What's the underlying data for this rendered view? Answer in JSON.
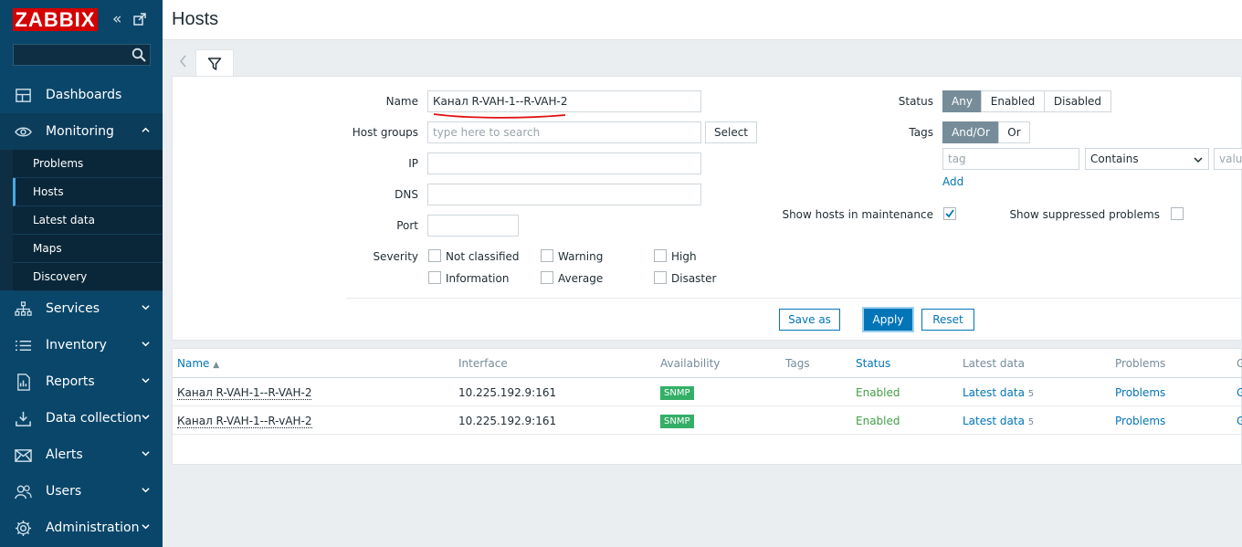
{
  "sidebar": {
    "logo": "ZABBIX",
    "collapse_glyph": "«",
    "expand_glyph": "⧉",
    "search_placeholder": "",
    "items": [
      {
        "label": "Dashboards",
        "icon": "dashboard-icon"
      },
      {
        "label": "Monitoring",
        "icon": "eye-icon"
      },
      {
        "label": "Services",
        "icon": "services-icon"
      },
      {
        "label": "Inventory",
        "icon": "list-icon"
      },
      {
        "label": "Reports",
        "icon": "reports-icon"
      },
      {
        "label": "Data collection",
        "icon": "download-icon"
      },
      {
        "label": "Alerts",
        "icon": "mail-icon"
      },
      {
        "label": "Users",
        "icon": "users-icon"
      },
      {
        "label": "Administration",
        "icon": "gear-icon"
      }
    ],
    "monitoring_sub": [
      "Problems",
      "Hosts",
      "Latest data",
      "Maps",
      "Discovery"
    ]
  },
  "header": {
    "title": "Hosts"
  },
  "filter": {
    "name_label": "Name",
    "name_value": "Канал R-VAH-1--R-VAH-2",
    "host_groups_label": "Host groups",
    "host_groups_placeholder": "type here to search",
    "select_label": "Select",
    "ip_label": "IP",
    "dns_label": "DNS",
    "port_label": "Port",
    "severity_label": "Severity",
    "severities": [
      "Not classified",
      "Warning",
      "High",
      "Information",
      "Average",
      "Disaster"
    ],
    "status_label": "Status",
    "status_options": [
      "Any",
      "Enabled",
      "Disabled"
    ],
    "tags_label": "Tags",
    "tags_options": [
      "And/Or",
      "Or"
    ],
    "tag_placeholder": "tag",
    "tag_operator": "Contains",
    "value_placeholder": "value",
    "add_label": "Add",
    "maintenance_label": "Show hosts in maintenance",
    "suppressed_label": "Show suppressed problems",
    "save_as_label": "Save as",
    "apply_label": "Apply",
    "reset_label": "Reset"
  },
  "table": {
    "headers": [
      "Name",
      "Interface",
      "Availability",
      "Tags",
      "Status",
      "Latest data",
      "Problems",
      "G"
    ],
    "sort_arrow": "▲",
    "rows": [
      {
        "name": "Канал R-VAH-1--R-VAH-2",
        "interface": "10.225.192.9:161",
        "availability": "SNMP",
        "status": "Enabled",
        "latest": "Latest data",
        "latest_count": "5",
        "problems": "Problems",
        "graphs": "G"
      },
      {
        "name": "Канал R-VAH-1--R-vAH-2",
        "interface": "10.225.192.9:161",
        "availability": "SNMP",
        "status": "Enabled",
        "latest": "Latest data",
        "latest_count": "5",
        "problems": "Problems",
        "graphs": "G"
      }
    ]
  }
}
